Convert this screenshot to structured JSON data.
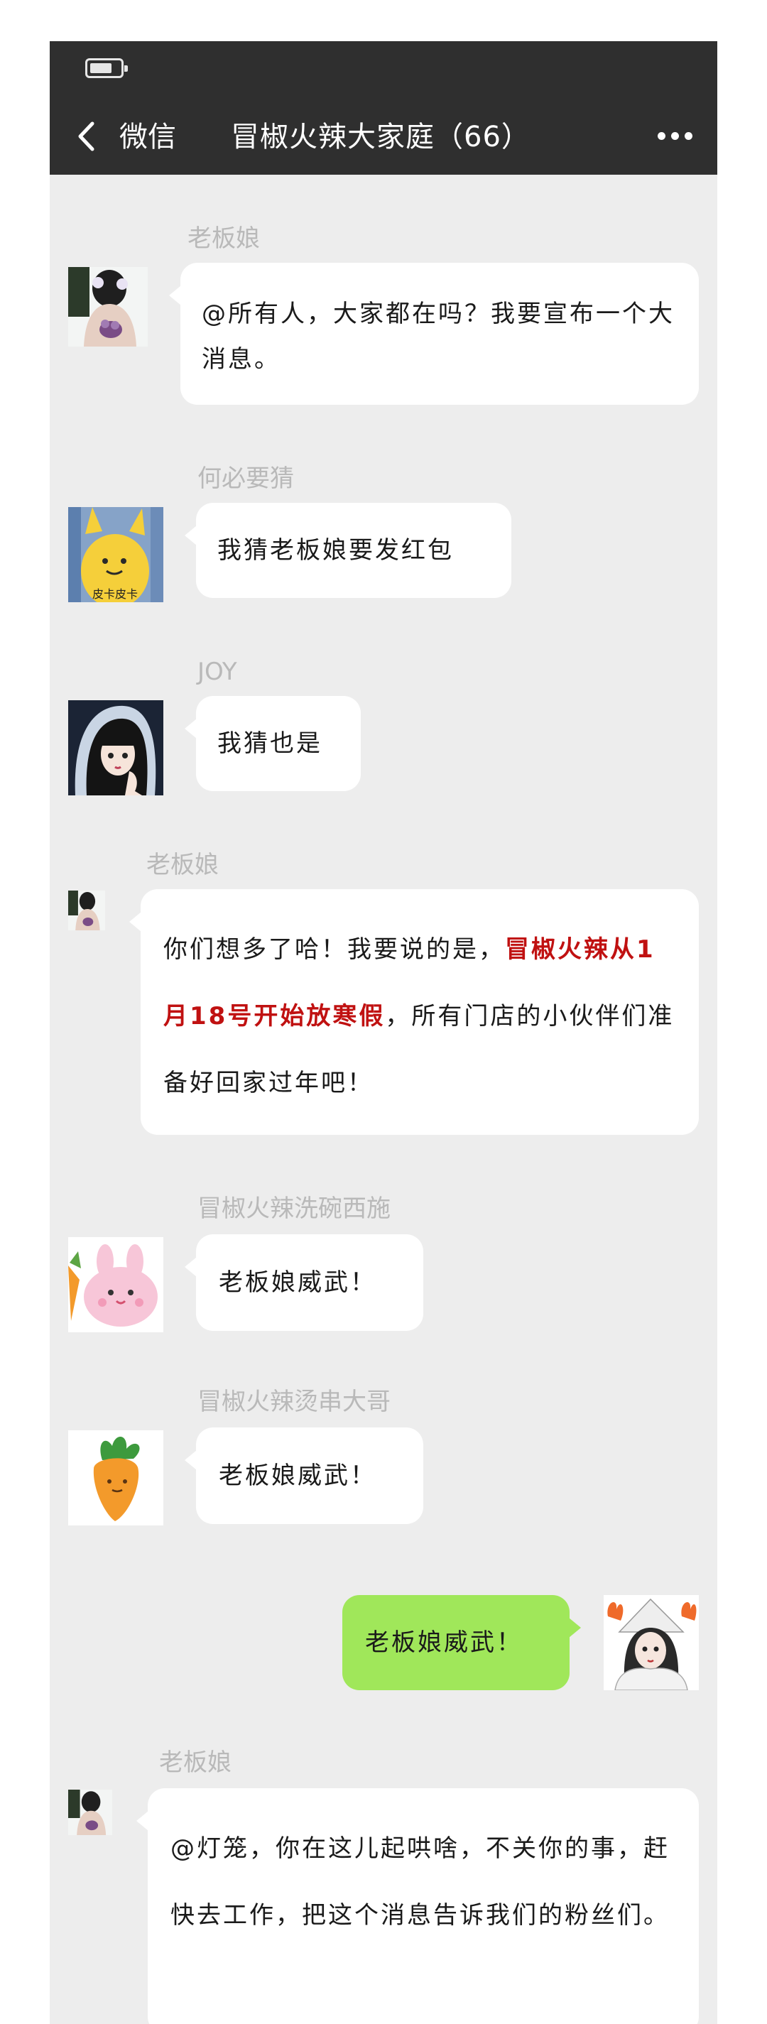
{
  "header": {
    "back_label": "微信",
    "title": "冒椒火辣大家庭（66）"
  },
  "messages": [
    {
      "sender": "老板娘",
      "text": "@所有人，大家都在吗？我要宣布一个大消息。"
    },
    {
      "sender": "何必要猜",
      "text": "我猜老板娘要发红包",
      "avatar_caption": "皮卡皮卡"
    },
    {
      "sender": "JOY",
      "text": "我猜也是"
    },
    {
      "sender": "老板娘",
      "text_before": "你们想多了哈！我要说的是，",
      "highlight": "冒椒火辣从1月18号开始放寒假",
      "text_after": "，所有门店的小伙伴们准备好回家过年吧！"
    },
    {
      "sender": "冒椒火辣洗碗西施",
      "text": "老板娘威武！"
    },
    {
      "sender": "冒椒火辣烫串大哥",
      "text": "老板娘威武！"
    },
    {
      "sender": "",
      "text": "老板娘威武！",
      "self": true
    },
    {
      "sender": "老板娘",
      "text": "@灯笼，你在这儿起哄啥，不关你的事，赶快去工作，把这个消息告诉我们的粉丝们。"
    }
  ],
  "colors": {
    "background": "#ededed",
    "topbar": "#2f2f2f",
    "self_bubble": "#a0e75a",
    "highlight": "#c01111"
  }
}
